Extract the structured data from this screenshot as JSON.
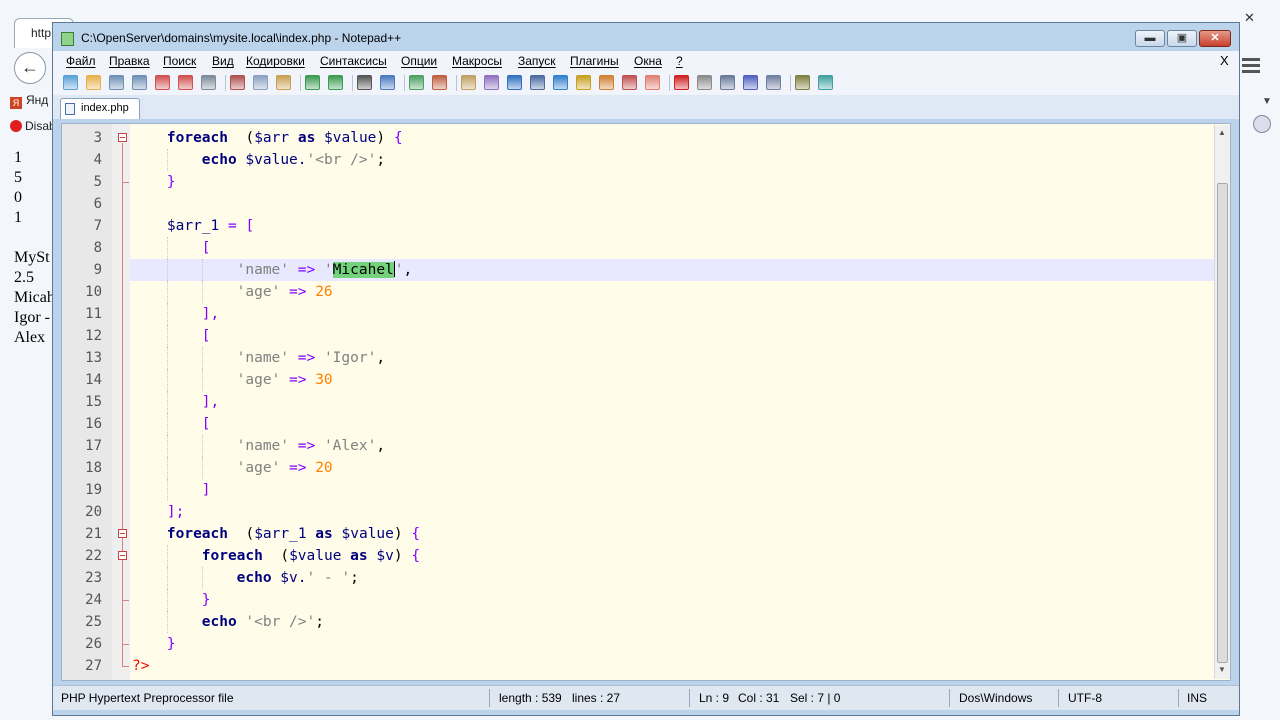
{
  "browser": {
    "tab_label": "http",
    "back_glyph": "←",
    "bookmarks": [
      {
        "label": "Янд",
        "icon": "yandex-icon"
      },
      {
        "label": "Disab",
        "icon": "no-entry-icon"
      }
    ],
    "page_lines": [
      "1",
      "5",
      "0",
      "1",
      "",
      "MySt",
      "2.5",
      "Micah",
      "Igor -",
      "Alex"
    ],
    "right_glyphs": {
      "close": "✕",
      "dropdown": "▼"
    }
  },
  "window": {
    "title": "C:\\OpenServer\\domains\\mysite.local\\index.php - Notepad++",
    "buttons": {
      "minimize": "▬",
      "maximize": "▣",
      "close": "✕"
    }
  },
  "menu": {
    "items": [
      "Файл",
      "Правка",
      "Поиск",
      "Вид",
      "Кодировки",
      "Синтаксисы",
      "Опции",
      "Макросы",
      "Запуск",
      "Плагины",
      "Окна",
      "?"
    ],
    "close": "X"
  },
  "toolbar": {
    "icons": [
      "new-file-icon",
      "open-file-icon",
      "save-icon",
      "save-all-icon",
      "close-icon",
      "close-all-icon",
      "print-icon",
      "cut-icon",
      "copy-icon",
      "paste-icon",
      "undo-icon",
      "redo-icon",
      "find-icon",
      "replace-icon",
      "zoom-in-icon",
      "zoom-out-icon",
      "sync-vertical-icon",
      "sync-horizontal-icon",
      "word-wrap-icon",
      "show-all-chars-icon",
      "indent-guide-icon",
      "user-lang-icon",
      "doc-map-icon",
      "function-list-icon",
      "folder-workspace-icon",
      "record-macro-icon",
      "stop-macro-icon",
      "play-macro-icon",
      "run-macro-multiple-icon",
      "save-macro-icon",
      "spellcheck-icon",
      "abc-check-icon"
    ]
  },
  "tab": {
    "label": "index.php"
  },
  "editor": {
    "current_line": 9,
    "lines": [
      {
        "n": "3",
        "indent": 1,
        "tokens": [
          [
            "kw",
            "foreach"
          ],
          [
            "",
            "  ("
          ],
          [
            "var",
            "$arr"
          ],
          [
            "",
            ""
          ],
          [
            "kw",
            " as "
          ],
          [
            "var",
            "$value"
          ],
          [
            "",
            ") "
          ],
          [
            "op",
            "{"
          ]
        ]
      },
      {
        "n": "4",
        "indent": 2,
        "tokens": [
          [
            "kw",
            "echo"
          ],
          [
            "var",
            " $value."
          ],
          [
            "str",
            "'<br />'"
          ],
          [
            "",
            ";"
          ]
        ]
      },
      {
        "n": "5",
        "indent": 1,
        "tokens": [
          [
            "op",
            "}"
          ]
        ]
      },
      {
        "n": "6",
        "indent": 0,
        "tokens": []
      },
      {
        "n": "7",
        "indent": 1,
        "tokens": [
          [
            "var",
            "$arr_1"
          ],
          [
            "op",
            " = ["
          ]
        ]
      },
      {
        "n": "8",
        "indent": 2,
        "tokens": [
          [
            "op",
            "["
          ]
        ]
      },
      {
        "n": "9",
        "indent": 3,
        "tokens": [
          [
            "str",
            "'name'"
          ],
          [
            "op",
            " => "
          ],
          [
            "str",
            "'"
          ],
          [
            "sel",
            "Micahel"
          ],
          [
            "caret",
            ""
          ],
          [
            "str",
            "'"
          ],
          [
            "",
            ","
          ]
        ]
      },
      {
        "n": "10",
        "indent": 3,
        "tokens": [
          [
            "str",
            "'age'"
          ],
          [
            "op",
            " => "
          ],
          [
            "num",
            "26"
          ]
        ]
      },
      {
        "n": "11",
        "indent": 2,
        "tokens": [
          [
            "op",
            "],"
          ]
        ]
      },
      {
        "n": "12",
        "indent": 2,
        "tokens": [
          [
            "op",
            "["
          ]
        ]
      },
      {
        "n": "13",
        "indent": 3,
        "tokens": [
          [
            "str",
            "'name'"
          ],
          [
            "op",
            " => "
          ],
          [
            "str",
            "'Igor'"
          ],
          [
            "",
            ","
          ]
        ]
      },
      {
        "n": "14",
        "indent": 3,
        "tokens": [
          [
            "str",
            "'age'"
          ],
          [
            "op",
            " => "
          ],
          [
            "num",
            "30"
          ]
        ]
      },
      {
        "n": "15",
        "indent": 2,
        "tokens": [
          [
            "op",
            "],"
          ]
        ]
      },
      {
        "n": "16",
        "indent": 2,
        "tokens": [
          [
            "op",
            "["
          ]
        ]
      },
      {
        "n": "17",
        "indent": 3,
        "tokens": [
          [
            "str",
            "'name'"
          ],
          [
            "op",
            " => "
          ],
          [
            "str",
            "'Alex'"
          ],
          [
            "",
            ","
          ]
        ]
      },
      {
        "n": "18",
        "indent": 3,
        "tokens": [
          [
            "str",
            "'age'"
          ],
          [
            "op",
            " => "
          ],
          [
            "num",
            "20"
          ]
        ]
      },
      {
        "n": "19",
        "indent": 2,
        "tokens": [
          [
            "op",
            "]"
          ]
        ]
      },
      {
        "n": "20",
        "indent": 1,
        "tokens": [
          [
            "op",
            "];"
          ]
        ]
      },
      {
        "n": "21",
        "indent": 1,
        "tokens": [
          [
            "kw",
            "foreach"
          ],
          [
            "",
            "  ("
          ],
          [
            "var",
            "$arr_1"
          ],
          [
            "kw",
            " as "
          ],
          [
            "var",
            "$value"
          ],
          [
            "",
            ") "
          ],
          [
            "op",
            "{"
          ]
        ]
      },
      {
        "n": "22",
        "indent": 2,
        "tokens": [
          [
            "kw",
            "foreach"
          ],
          [
            "",
            "  ("
          ],
          [
            "var",
            "$value"
          ],
          [
            "kw",
            " as "
          ],
          [
            "var",
            "$v"
          ],
          [
            "",
            ") "
          ],
          [
            "op",
            "{"
          ]
        ]
      },
      {
        "n": "23",
        "indent": 3,
        "tokens": [
          [
            "kw",
            "echo"
          ],
          [
            "var",
            " $v."
          ],
          [
            "str",
            "' - '"
          ],
          [
            "",
            ";"
          ]
        ]
      },
      {
        "n": "24",
        "indent": 2,
        "tokens": [
          [
            "op",
            "}"
          ]
        ]
      },
      {
        "n": "25",
        "indent": 2,
        "tokens": [
          [
            "kw",
            "echo"
          ],
          [
            "str",
            " '<br />'"
          ],
          [
            "",
            ";"
          ]
        ]
      },
      {
        "n": "26",
        "indent": 1,
        "tokens": [
          [
            "op",
            "}"
          ]
        ]
      },
      {
        "n": "27",
        "indent": 0,
        "tokens": [
          [
            "php",
            "?>"
          ]
        ]
      }
    ]
  },
  "statusbar": {
    "filetype": "PHP Hypertext Preprocessor file",
    "length": "length : 539",
    "lines": "lines : 27",
    "ln": "Ln : 9",
    "col": "Col : 31",
    "sel": "Sel : 7 | 0",
    "eol": "Dos\\Windows",
    "encoding": "UTF-8",
    "mode": "INS"
  },
  "colors": {
    "editor_bg": "#fffde9",
    "current_line": "#e8e8ff",
    "selection": "#74d27c",
    "keyword": "#00007e",
    "number": "#ff8000",
    "string": "#808080",
    "operator": "#8000ff"
  }
}
